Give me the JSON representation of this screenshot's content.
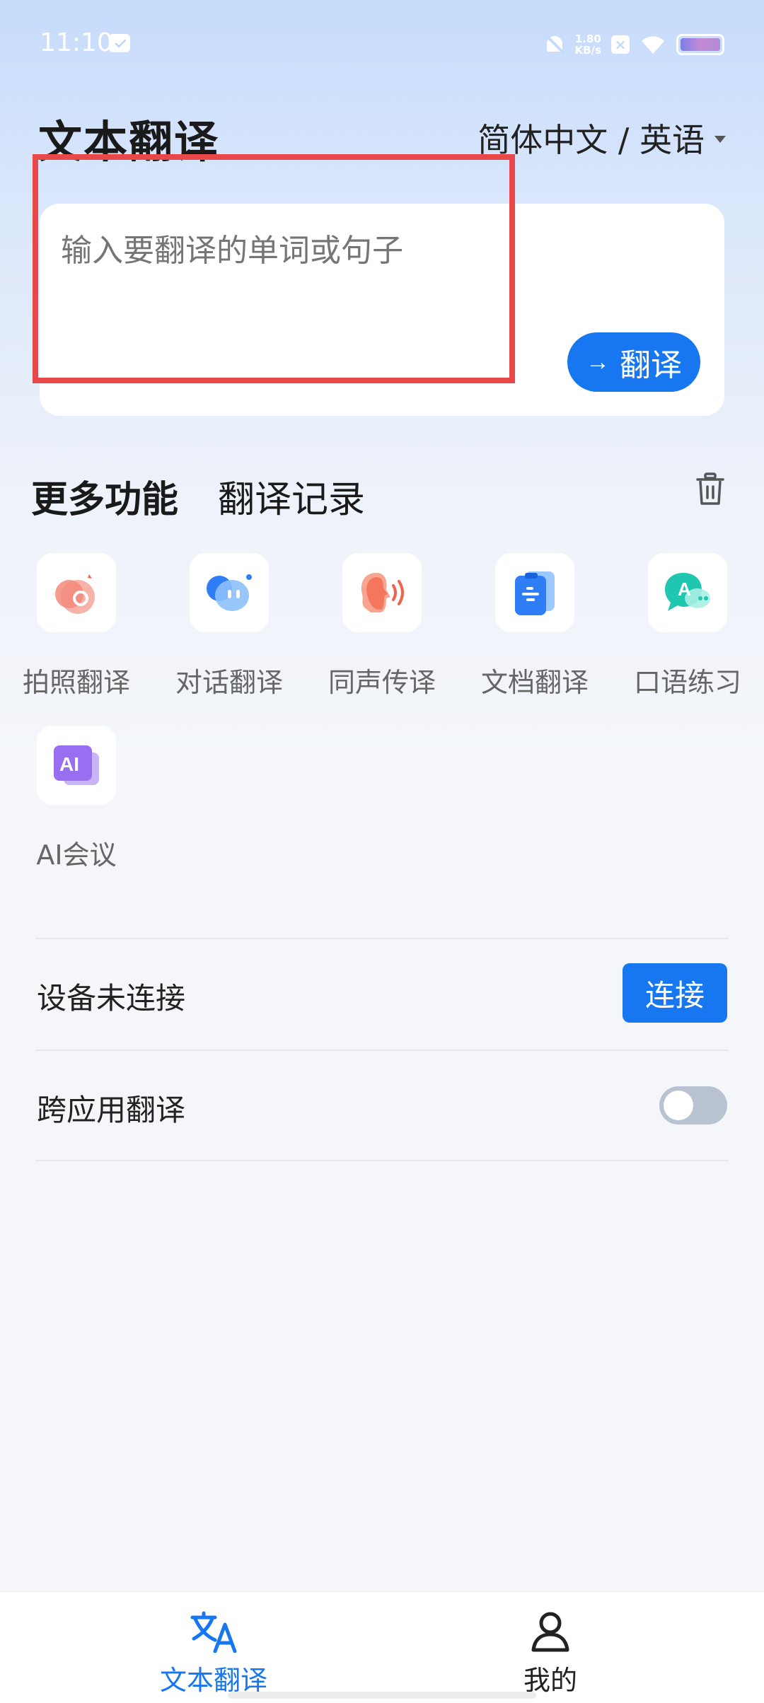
{
  "status_bar": {
    "time": "11:10",
    "net_speed_value": "1.80",
    "net_speed_unit": "KB/s",
    "icons": [
      "message-icon",
      "bell-off-icon",
      "x-icon",
      "wifi-icon",
      "battery-icon"
    ]
  },
  "header": {
    "title": "文本翻译",
    "language_pair": "简体中文 / 英语"
  },
  "input_card": {
    "placeholder": "输入要翻译的单词或句子",
    "value": "",
    "translate_button": "翻译"
  },
  "section": {
    "more_features_tab": "更多功能",
    "history_tab": "翻译记录"
  },
  "features": [
    {
      "label": "拍照翻译",
      "icon": "camera-icon"
    },
    {
      "label": "对话翻译",
      "icon": "chat-bubble-icon"
    },
    {
      "label": "同声传译",
      "icon": "speaking-head-icon"
    },
    {
      "label": "文档翻译",
      "icon": "document-icon"
    },
    {
      "label": "口语练习",
      "icon": "speech-bubble-icon"
    },
    {
      "label": "AI会议",
      "icon": "ai-icon"
    }
  ],
  "settings": {
    "device_status": "设备未连接",
    "connect_button": "连接",
    "cross_app_label": "跨应用翻译",
    "cross_app_enabled": false
  },
  "bottom_nav": {
    "items": [
      {
        "label": "文本翻译",
        "active": true,
        "icon": "translate-icon"
      },
      {
        "label": "我的",
        "active": false,
        "icon": "person-icon"
      }
    ]
  },
  "colors": {
    "accent": "#1677f0",
    "highlight": "#e84848"
  }
}
